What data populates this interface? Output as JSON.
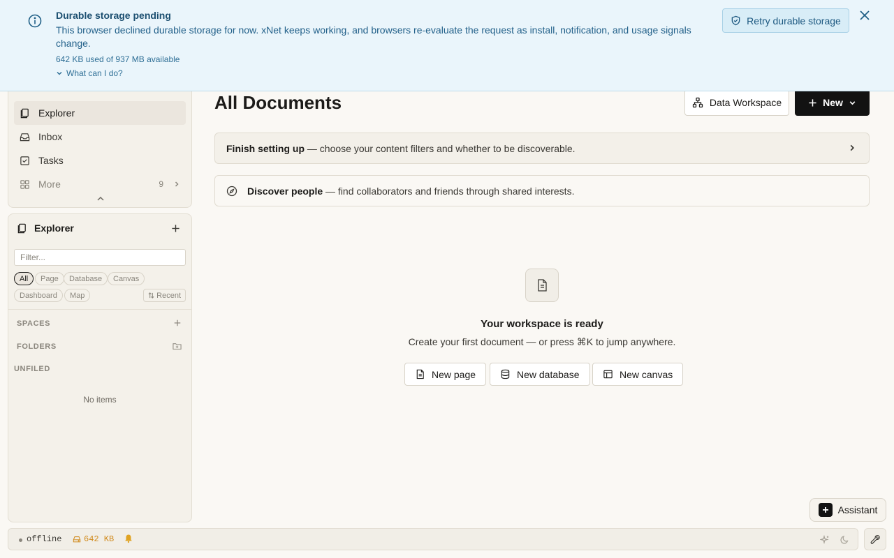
{
  "banner": {
    "title": "Durable storage pending",
    "message": "This browser declined durable storage for now. xNet keeps working, and browsers re-evaluate the request as install, notification, and usage signals change.",
    "usage": "642 KB used of 937 MB available",
    "more_label": "What can I do?",
    "retry_label": "Retry durable storage",
    "info_icon": "info-circle-icon",
    "close_icon": "close-icon"
  },
  "sidebar": {
    "nav_items": [
      {
        "label": "Explorer",
        "icon": "explorer-icon",
        "active": true
      },
      {
        "label": "Inbox",
        "icon": "inbox-icon"
      },
      {
        "label": "Tasks",
        "icon": "tasks-icon"
      },
      {
        "label": "More",
        "icon": "grid-icon",
        "count": "9"
      }
    ],
    "explorer": {
      "title": "Explorer",
      "filter_placeholder": "Filter...",
      "chips": [
        "All",
        "Page",
        "Database",
        "Canvas",
        "Dashboard",
        "Map"
      ],
      "sort_label": "Recent",
      "sections": {
        "spaces": "SPACES",
        "folders": "FOLDERS",
        "unfiled": "UNFILED"
      },
      "empty_label": "No items"
    }
  },
  "main": {
    "title": "All Documents",
    "workspace_label": "Data Workspace",
    "new_label": "New",
    "setup_card": {
      "bold": "Finish setting up",
      "rest": " — choose your content filters and whether to be discoverable."
    },
    "discover_card": {
      "bold": "Discover people",
      "rest": " — find collaborators and friends through shared interests."
    },
    "empty_state": {
      "title": "Your workspace is ready",
      "subtitle": "Create your first document — or press ⌘K to jump anywhere.",
      "buttons": [
        "New page",
        "New database",
        "New canvas"
      ]
    },
    "assistant_label": "Assistant"
  },
  "status_bar": {
    "connection": "offline",
    "storage": "642 KB"
  },
  "colors": {
    "banner_bg": "#eaf5fb",
    "accent_dark": "#121212",
    "warning": "#d18b1e"
  }
}
